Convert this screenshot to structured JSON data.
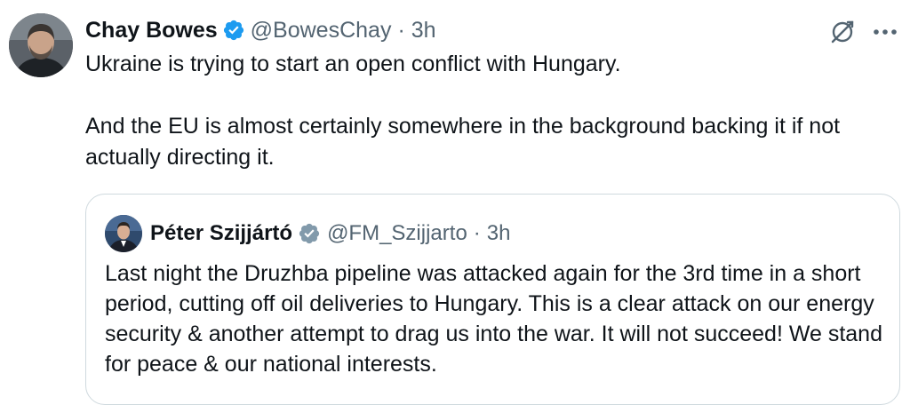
{
  "tweet": {
    "author": {
      "display_name": "Chay Bowes",
      "handle": "@BowesChay",
      "separator": "·",
      "time": "3h",
      "verified_icon": "blue-verified-badge"
    },
    "text_lines": [
      "Ukraine is trying to start an open conflict with Hungary.",
      "And the EU is almost certainly somewhere in the background backing it if not actually directing it."
    ],
    "actions": {
      "grok_icon": "grok-icon",
      "more_icon": "more-horizontal-icon"
    }
  },
  "quoted_tweet": {
    "author": {
      "display_name": "Péter Szijjártó",
      "handle": "@FM_Szijjarto",
      "separator": "·",
      "time": "3h",
      "verified_icon": "gray-government-verified-badge"
    },
    "text": "Last night the Druzhba pipeline was attacked again for the 3rd time in a short period, cutting off oil deliveries to Hungary. This is a clear attack on our energy security & another attempt to drag us into the war. It will not succeed! We stand for peace & our national interests."
  },
  "colors": {
    "text_primary": "#0f1419",
    "text_secondary": "#536471",
    "verified_blue": "#1d9bf0",
    "verified_gray": "#829aab",
    "border": "#cfd9de"
  }
}
